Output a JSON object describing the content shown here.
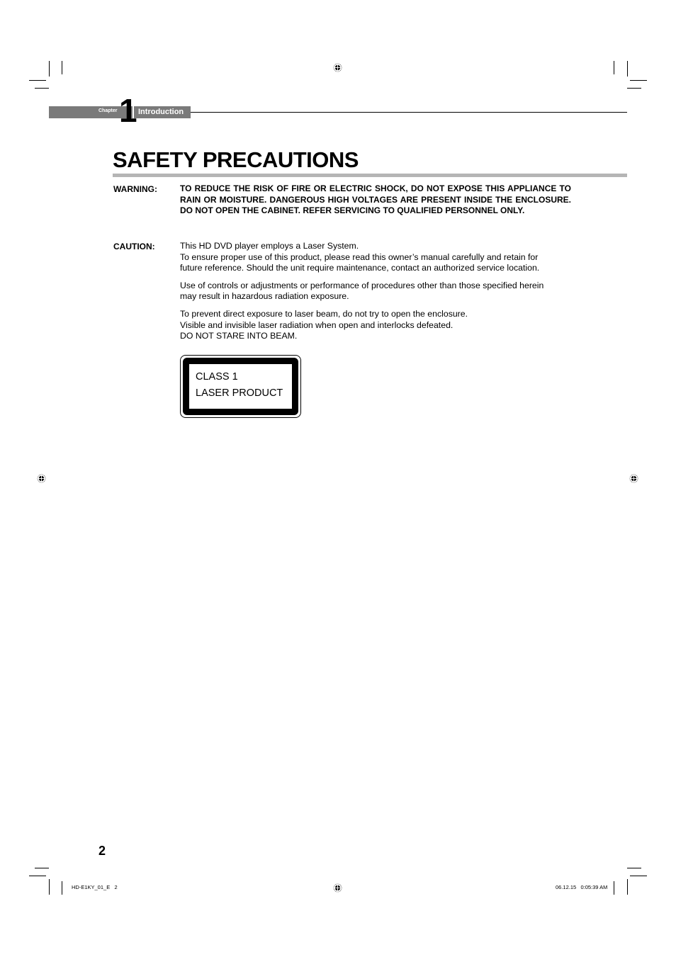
{
  "header": {
    "chapter_label": "Chapter",
    "chapter_number": "1",
    "chapter_title": "Introduction"
  },
  "page_title": "SAFETY PRECAUTIONS",
  "warning": {
    "label": "WARNING:",
    "text": "TO REDUCE THE RISK OF FIRE OR ELECTRIC SHOCK, DO NOT EXPOSE THIS APPLIANCE TO RAIN OR MOISTURE. DANGEROUS HIGH VOLTAGES ARE PRESENT INSIDE THE ENCLOSURE. DO NOT OPEN THE CABINET. REFER SERVICING TO QUALIFIED PERSONNEL ONLY."
  },
  "caution": {
    "label": "CAUTION:",
    "paragraphs": [
      [
        "This HD DVD player employs a Laser System.",
        "To ensure proper use of this product, please read this owner’s manual carefully and retain for",
        "future reference. Should the unit require maintenance, contact an authorized service location."
      ],
      [
        "Use of controls or adjustments or performance of procedures other than those specified herein",
        "may result in hazardous radiation exposure."
      ],
      [
        "To prevent direct exposure to laser beam, do not try to open the enclosure.",
        "Visible and invisible laser radiation when open and interlocks defeated.",
        "DO NOT STARE INTO BEAM."
      ]
    ]
  },
  "laser_label": {
    "line1": "CLASS 1",
    "line2": "LASER PRODUCT"
  },
  "footer": {
    "page_number": "2",
    "file_info": "HD-E1KY_01_E   2",
    "date_info": "06.12.15   0:05:39 AM"
  },
  "colors": {
    "chapter_bar": "#7a7a7a",
    "title_rule": "#b5b5b5"
  }
}
